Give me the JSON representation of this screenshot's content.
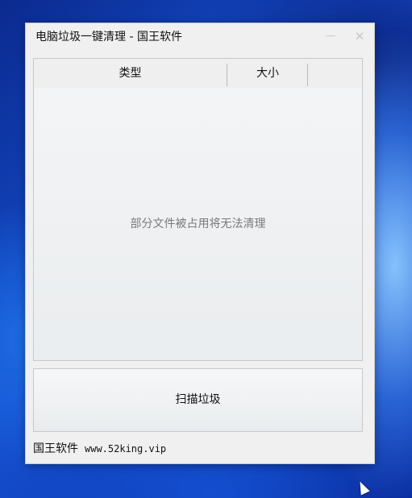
{
  "window": {
    "title": "电脑垃圾一键清理 - 国王软件",
    "controls": {
      "minimize": "—",
      "close": "✕"
    }
  },
  "table": {
    "columns": [
      "类型",
      "大小"
    ],
    "empty_message": "部分文件被占用将无法清理"
  },
  "scan_button": {
    "label": "扫描垃圾"
  },
  "footer": {
    "brand": "国王软件",
    "url": "www.52king.vip"
  },
  "colors": {
    "window_bg": "#f0f0f0",
    "desktop": "#1550d0"
  }
}
